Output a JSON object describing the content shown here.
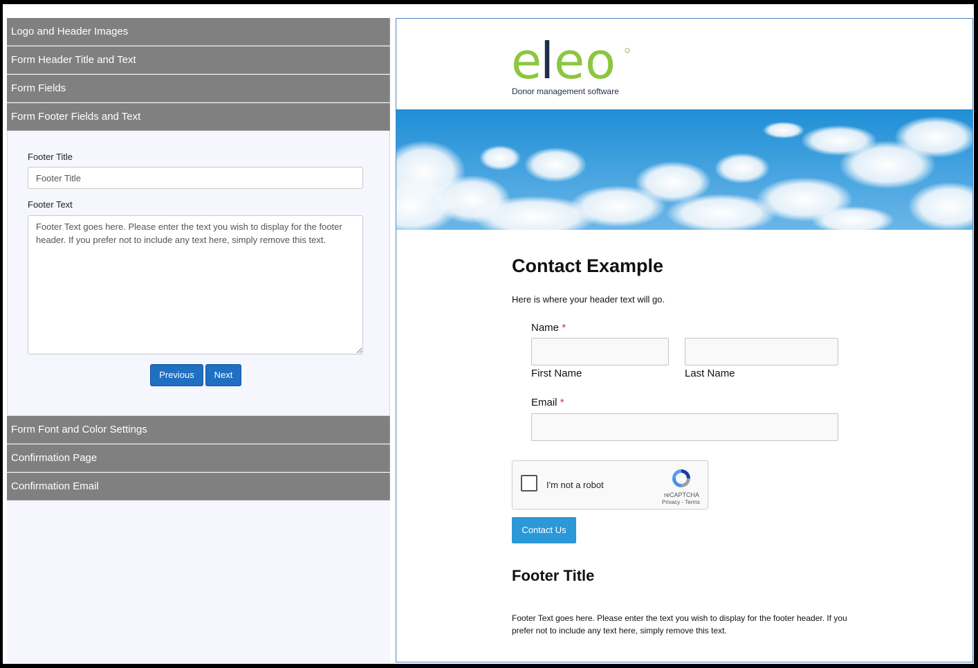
{
  "sidebar": {
    "sections_top": [
      {
        "label": "Logo and Header Images"
      },
      {
        "label": "Form Header Title and Text"
      },
      {
        "label": "Form Fields"
      },
      {
        "label": "Form Footer Fields and Text"
      }
    ],
    "sections_bottom": [
      {
        "label": "Form Font and Color Settings"
      },
      {
        "label": "Confirmation Page"
      },
      {
        "label": "Confirmation Email"
      }
    ],
    "footer_panel": {
      "footer_title_label": "Footer Title",
      "footer_title_value": "Footer Title",
      "footer_text_label": "Footer Text",
      "footer_text_value": "Footer Text goes here. Please enter the text you wish to display for the footer header. If you prefer not to include any text here, simply remove this text.",
      "previous_label": "Previous",
      "next_label": "Next"
    }
  },
  "preview": {
    "logo_text": "eleo",
    "logo_tagline": "Donor management software",
    "title": "Contact Example",
    "header_text": "Here is where your header text will go.",
    "name_label": "Name",
    "required_mark": "*",
    "first_name_label": "First Name",
    "last_name_label": "Last Name",
    "email_label": "Email",
    "captcha_text": "I'm not a robot",
    "captcha_brand": "reCAPTCHA",
    "captcha_links": "Privacy - Terms",
    "submit_label": "Contact Us",
    "footer_title": "Footer Title",
    "footer_text": "Footer Text goes here. Please enter the text you wish to display for the footer header. If you prefer not to include any text here, simply remove this text."
  },
  "colors": {
    "accordion_header": "#808080",
    "primary_button": "#1f6fc2",
    "contact_button": "#2b98d8",
    "logo_green": "#8cc63f",
    "logo_navy": "#1e2d4a"
  }
}
